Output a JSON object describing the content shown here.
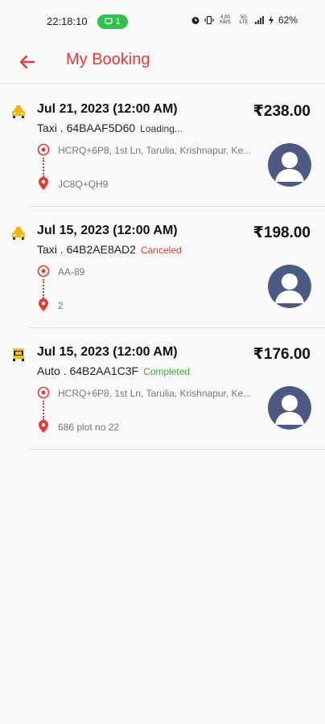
{
  "status_bar": {
    "time": "22:18:10",
    "pill_count": "1",
    "net_speed_1": "4.00 KB/S",
    "net_type": "5G LTE",
    "battery": "62%"
  },
  "header": {
    "title": "My Booking"
  },
  "colors": {
    "accent": "#e53935",
    "completed": "#3aa745",
    "avatar": "#4a5a85"
  },
  "bookings": [
    {
      "vehicle_icon": "taxi-icon",
      "date": "Jul 21, 2023 (12:00 AM)",
      "price": "₹238.00",
      "vehicle": "Taxi . 64BAAF5D60",
      "status": "Loading...",
      "status_kind": "loading",
      "pickup": "HCRQ+6P8, 1st Ln, Tarulia, Krishnapur, Ke...",
      "drop": "JC8Q+QH9"
    },
    {
      "vehicle_icon": "taxi-icon",
      "date": "Jul 15, 2023 (12:00 AM)",
      "price": "₹198.00",
      "vehicle": "Taxi . 64B2AE8AD2",
      "status": "Canceled",
      "status_kind": "canceled",
      "pickup": "AA-89",
      "drop": "2"
    },
    {
      "vehicle_icon": "auto-rickshaw-icon",
      "date": "Jul 15, 2023 (12:00 AM)",
      "price": "₹176.00",
      "vehicle": "Auto . 64B2AA1C3F",
      "status": "Completed",
      "status_kind": "completed",
      "pickup": "HCRQ+6P8, 1st Ln, Tarulia, Krishnapur, Ke...",
      "drop": "686 plot no 22"
    }
  ]
}
